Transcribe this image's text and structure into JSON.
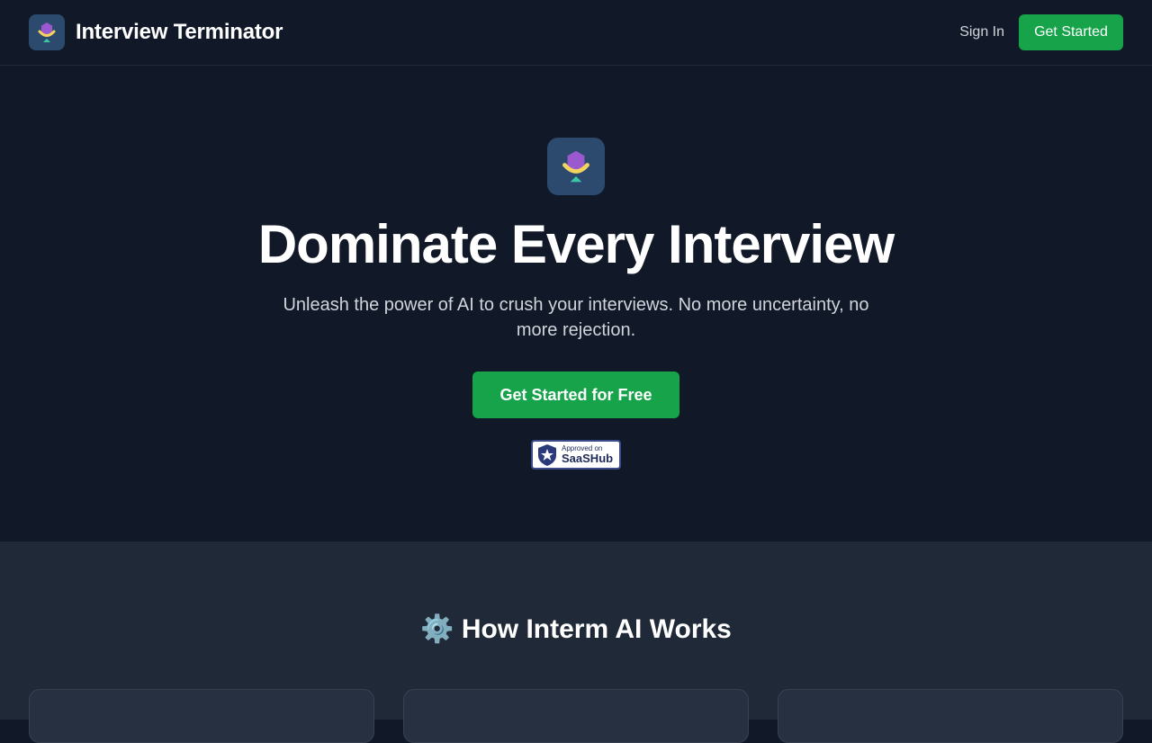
{
  "header": {
    "brand_name": "Interview Terminator",
    "sign_in_label": "Sign In",
    "get_started_label": "Get Started"
  },
  "hero": {
    "title": "Dominate Every Interview",
    "subtitle": "Unleash the power of AI to crush your interviews. No more uncertainty, no more rejection.",
    "cta_label": "Get Started for Free",
    "badge": {
      "small": "Approved on",
      "big": "SaaSHub"
    }
  },
  "how": {
    "icon": "gear-icon",
    "title": "⚙️ How Interm AI Works",
    "cards": 3
  },
  "colors": {
    "background": "#111827",
    "section": "#1f2937",
    "accent": "#16a34a",
    "logo_bg": "#2c4a6e"
  }
}
